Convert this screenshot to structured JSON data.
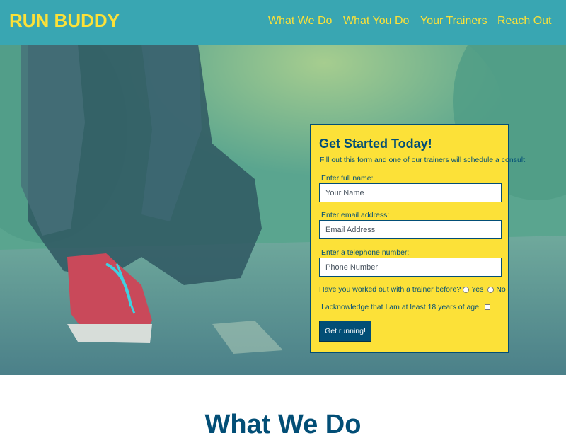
{
  "header": {
    "logo": "RUN BUDDY",
    "nav": [
      {
        "label": "What We Do"
      },
      {
        "label": "What You Do"
      },
      {
        "label": "Your Trainers"
      },
      {
        "label": "Reach Out"
      }
    ]
  },
  "form": {
    "title": "Get Started Today!",
    "description": "Fill out this form and one of our trainers will schedule a consult.",
    "name_label": "Enter full name:",
    "name_placeholder": "Your Name",
    "email_label": "Enter email address:",
    "email_placeholder": "Email Address",
    "phone_label": "Enter a telephone number:",
    "phone_placeholder": "Phone Number",
    "trainer_question": "Have you worked out with a trainer before?",
    "yes_label": "Yes",
    "no_label": "No",
    "acknowledge": "I acknowledge that I am at least 18 years of age.",
    "submit_label": "Get running!"
  },
  "section": {
    "title": "What We Do"
  },
  "colors": {
    "primary": "#39a6b2",
    "accent": "#fce138",
    "dark": "#024e76"
  }
}
